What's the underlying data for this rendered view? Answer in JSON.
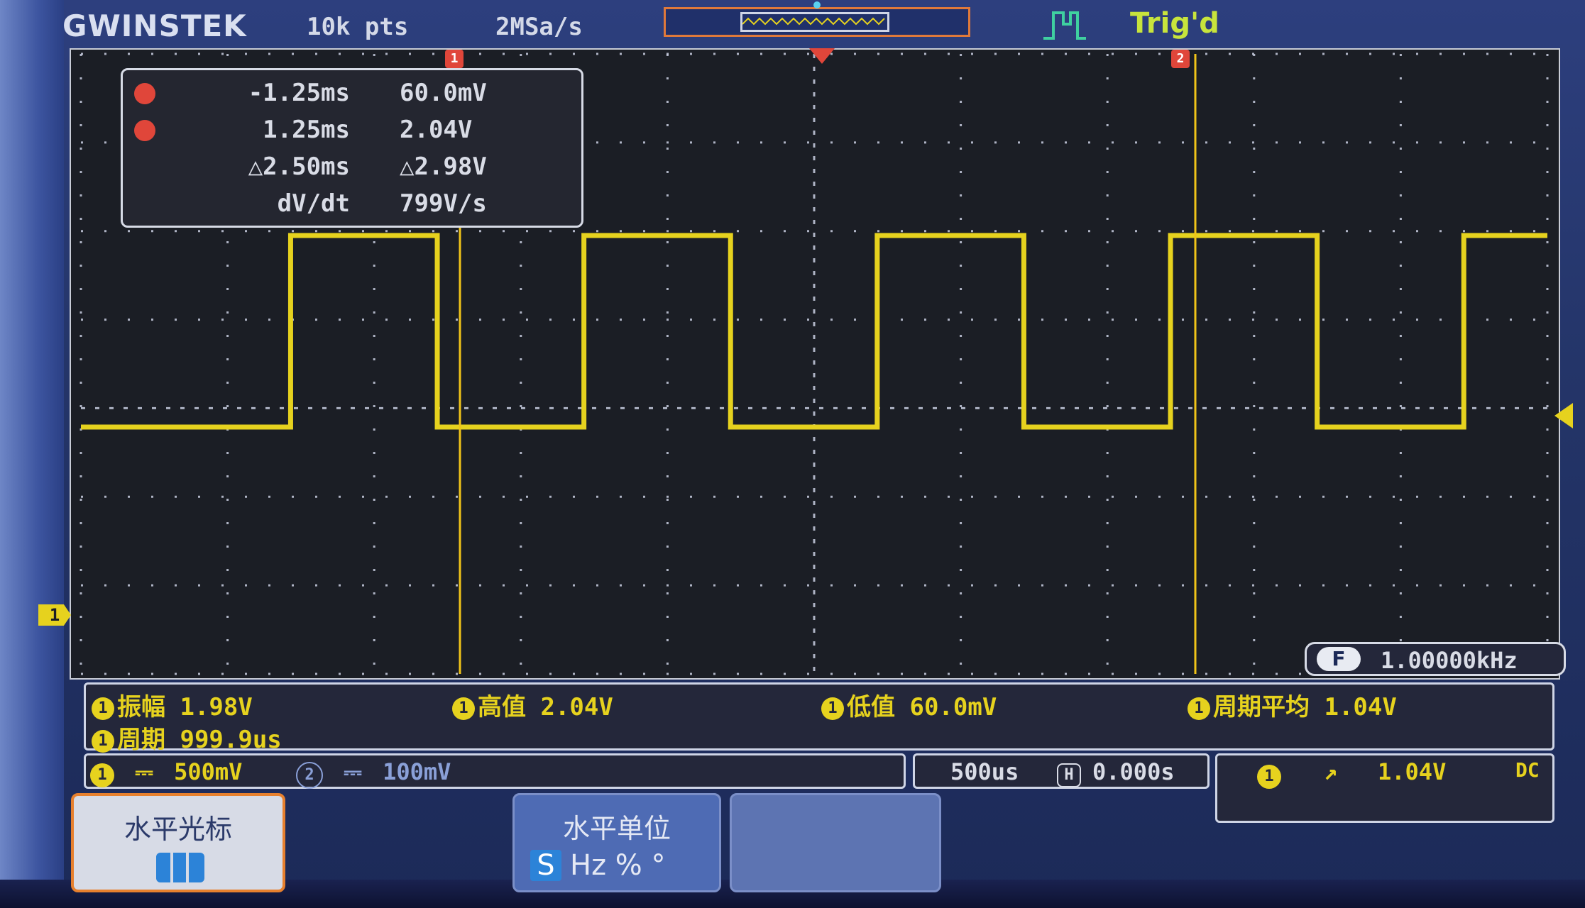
{
  "header": {
    "brand": "GWINSTEK",
    "record_length": "10k pts",
    "sample_rate": "2MSa/s",
    "trigger_status": "Trig'd"
  },
  "cursors": {
    "cursor1_marker": "1",
    "cursor2_marker": "2",
    "cursor1_time": "-1.25ms",
    "cursor1_value": "60.0mV",
    "cursor2_time": "1.25ms",
    "cursor2_value": "2.04V",
    "delta_time": "△2.50ms",
    "delta_value": "△2.98V",
    "slope_label": "dV/dt",
    "slope_value": "799V/s"
  },
  "frequency": {
    "icon_label": "F",
    "value": "1.00000kHz"
  },
  "channel_marker": "1",
  "measurements": [
    {
      "channel": "1",
      "text": "振幅 1.98V"
    },
    {
      "channel": "1",
      "text": "高值 2.04V"
    },
    {
      "channel": "1",
      "text": "低值 60.0mV"
    },
    {
      "channel": "1",
      "text": "周期平均 1.04V"
    },
    {
      "channel": "1",
      "text": "周期 999.9us"
    }
  ],
  "status": {
    "ch1_num": "1",
    "ch1_coupling": "⎓",
    "ch1_scale": "500mV",
    "ch2_num": "2",
    "ch2_coupling": "⎓",
    "ch2_scale": "100mV",
    "timebase": "500us",
    "h_icon": "H",
    "h_position": "0.000s",
    "trig_source": "1",
    "trig_slope": "↗",
    "trig_level": "1.04V",
    "trig_coupling": "DC"
  },
  "softkeys": {
    "key1_title": "水平光标",
    "key2_title": "水平单位",
    "key2_unit_s": "S",
    "key2_units_rest": "Hz % °"
  },
  "colors": {
    "trace": "#e6d21e",
    "cursor_line": "#f0c419",
    "grid": "#c9cfe2",
    "accent_orange": "#e7802e"
  }
}
